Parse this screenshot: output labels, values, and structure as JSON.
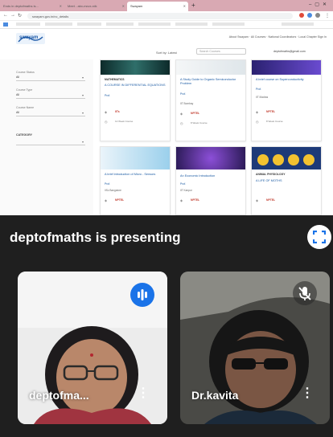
{
  "browser": {
    "tabs": [
      {
        "label": "Ends in deptofmaths is..."
      },
      {
        "label": "Meet - abx-mcvx-rdk"
      },
      {
        "label": "Swayam"
      }
    ],
    "url": "swayam.gov.in/nc_details"
  },
  "site": {
    "logo": "swayam",
    "toplinks": "About Swayam · All Courses · National Coordinators · Local Chapter   Sign In",
    "sort_label": "Sort by: Latest",
    "search_placeholder": "Search Courses",
    "email": "deptofmaths@gmail.com",
    "filters": [
      {
        "label": "Course Status",
        "value": "All"
      },
      {
        "label": "Course Type",
        "value": "All"
      },
      {
        "label": "Course Name",
        "value": "All"
      }
    ],
    "category_label": "CATEGORY"
  },
  "cards": [
    {
      "tag": "MATHEMATICS",
      "title": "A COURSE IN DIFFERENTIAL EQUATIONS",
      "prof": "Prof. ",
      "inst": "",
      "nptel": "IITs",
      "meta": "12 Week Course"
    },
    {
      "tag": "",
      "title": "A Study Guide to Organic Semiconductor Problem",
      "prof": "Prof. ",
      "inst": "IIT Bombay",
      "nptel": "NPTEL",
      "meta": "8 Week Course"
    },
    {
      "tag": "",
      "title": "A brief course on Superconductivity",
      "prof": "Prof. ",
      "inst": "IIT Madras",
      "nptel": "NPTEL",
      "meta": "8 Week Course"
    },
    {
      "tag": "",
      "title": "A brief introduction of Micro - Sensors",
      "prof": "Prof. ",
      "inst": "IISc Bangalore",
      "nptel": "NPTEL",
      "meta": ""
    },
    {
      "tag": "",
      "title": "An Economic Introduction",
      "prof": "Prof. ",
      "inst": "IIT Kanpur",
      "nptel": "NPTEL",
      "meta": ""
    },
    {
      "tag": "ANIMAL PHYSIOLOGY",
      "title": "A LIFE OF MOTHS",
      "prof": "",
      "inst": "",
      "nptel": "NPTEL",
      "meta": ""
    }
  ],
  "meet": {
    "presenting_text": "deptofmaths is presenting",
    "participants": [
      {
        "name": "deptofma..."
      },
      {
        "name": "Dr.kavita"
      }
    ]
  },
  "colors": {
    "tabbar": "#d9a9b3",
    "meet_bg": "#1f1f1f",
    "speaking_blue": "#1a73e8"
  }
}
